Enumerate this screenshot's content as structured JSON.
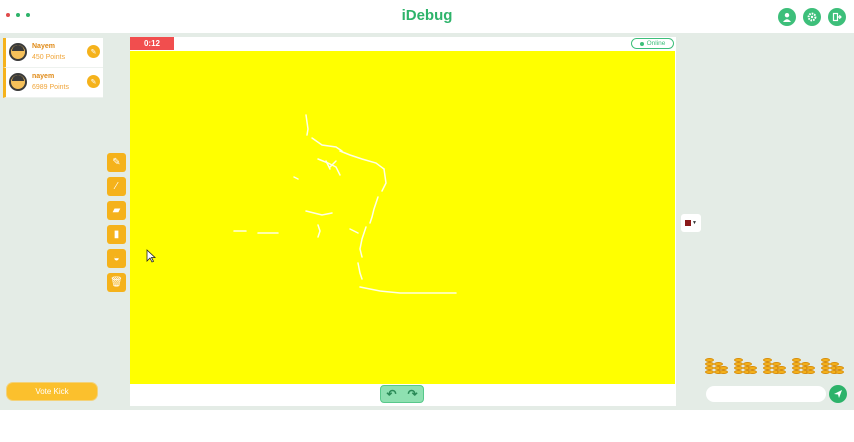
{
  "app": {
    "title": "iDebug",
    "window_dot_colors": [
      "#e04b4b",
      "#2db36a",
      "#2db36a"
    ],
    "accent": "#2db36a"
  },
  "top_icons": [
    {
      "name": "user-icon",
      "glyph": "👤"
    },
    {
      "name": "gear-icon",
      "glyph": "⚙"
    },
    {
      "name": "exit-icon",
      "glyph": "⇥"
    }
  ],
  "players": [
    {
      "name": "Nayem",
      "points": "450 Points"
    },
    {
      "name": "nayem",
      "points": "6989 Points"
    }
  ],
  "tools": [
    {
      "name": "pencil-tool-icon",
      "glyph": "✎"
    },
    {
      "name": "brush-tool-icon",
      "glyph": "⁄"
    },
    {
      "name": "eraser-tool-icon",
      "glyph": "▰"
    },
    {
      "name": "marker-tool-icon",
      "glyph": "▮"
    },
    {
      "name": "fill-tool-icon",
      "glyph": "◒"
    },
    {
      "name": "trash-icon",
      "glyph": "🗑"
    }
  ],
  "board": {
    "timer": "0:12",
    "status": "Online",
    "canvas_color": "#ffff00",
    "undo_glyph": "↶",
    "redo_glyph": "↷"
  },
  "color_picker": {
    "selected": "#8b1a1a"
  },
  "vote_kick": {
    "label": "Vote Kick"
  },
  "chat": {
    "value": "",
    "placeholder": ""
  }
}
